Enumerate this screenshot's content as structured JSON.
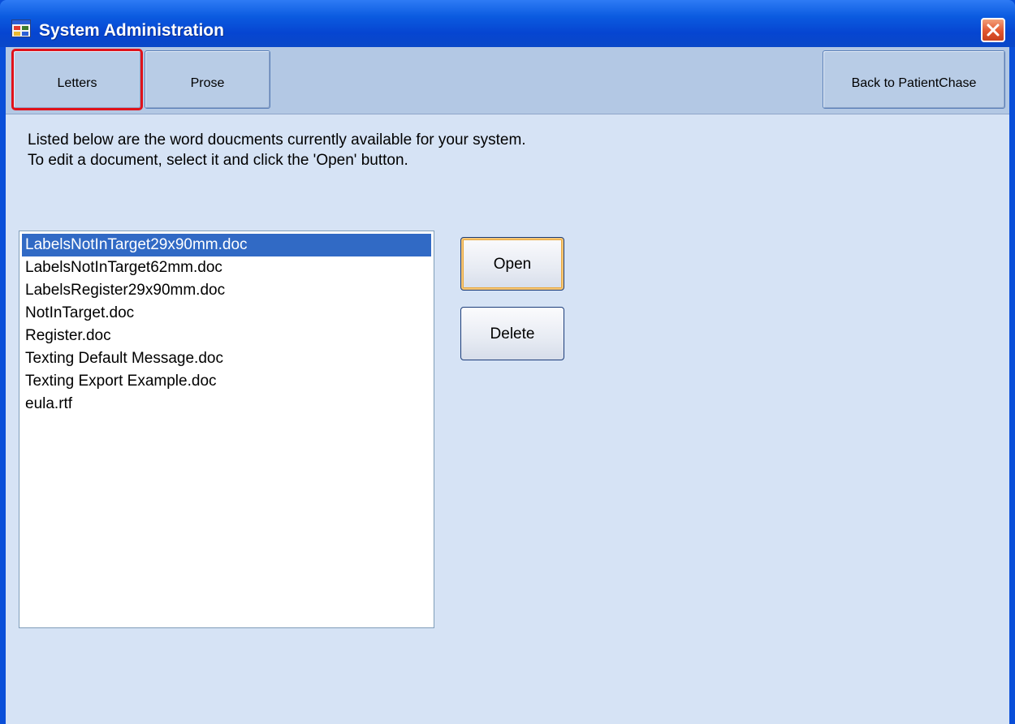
{
  "window": {
    "title": "System Administration"
  },
  "toolbar": {
    "letters_label": "Letters",
    "prose_label": "Prose",
    "back_label": "Back to PatientChase"
  },
  "main": {
    "instruction_line1": "Listed below are the word doucments currently available for your system.",
    "instruction_line2": "To edit a document, select it and click the 'Open' button.",
    "documents": [
      "LabelsNotInTarget29x90mm.doc",
      "LabelsNotInTarget62mm.doc",
      "LabelsRegister29x90mm.doc",
      "NotInTarget.doc",
      "Register.doc",
      "Texting Default Message.doc",
      "Texting Export Example.doc",
      "eula.rtf"
    ],
    "selected_document": "LabelsNotInTarget29x90mm.doc",
    "open_label": "Open",
    "delete_label": "Delete"
  },
  "colors": {
    "titlebar": "#0A4FD9",
    "client_background": "#D6E3F5",
    "toolbar_background": "#B3C8E4",
    "selection": "#316AC5",
    "active_tab_outline": "#E0121A"
  },
  "icons": {
    "app": "window-app-icon",
    "close": "close-x-icon"
  }
}
